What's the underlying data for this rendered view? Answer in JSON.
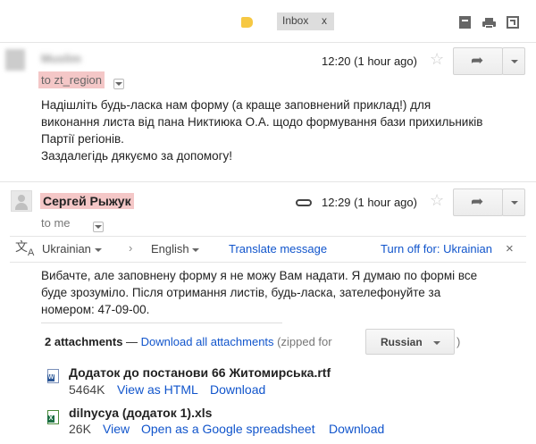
{
  "toolbar": {
    "label_tag": "Inbox",
    "label_remove": "x"
  },
  "message1": {
    "sender": "Muslim",
    "time": "12:20 (1 hour ago)",
    "to": "to zt_region",
    "body": [
      "Надішліть будь-ласка нам форму (а краще заповнений приклад!) для",
      "виконання листа від пана Никтиюка О.А. щодо формування бази прихильників",
      "Партії регіонів.",
      "Заздалегідь дякуємо за допомогу!"
    ]
  },
  "message2": {
    "sender": "Сергей Рыжук",
    "time": "12:29 (1 hour ago)",
    "to": "to me",
    "translate": {
      "from_lang": "Ukrainian",
      "to_lang": "English",
      "translate_link": "Translate message",
      "turn_off": "Turn off for: Ukrainian",
      "close": "×"
    },
    "body": [
      "Вибачте, але заповнену форму я не можу Вам надати. Я думаю по формі все",
      "буде зрозуміло. Після отримання листів, будь-ласка, зателефонуйте за",
      "номером: 47-09-00."
    ],
    "attachments_count": "2 attachments",
    "attachments_sep": "—",
    "download_all": "Download all attachments",
    "zipped_for": "(zipped for",
    "zipped_close": ")",
    "zip_lang": "Russian",
    "attachments": [
      {
        "name": "Додаток до постанови 66 Житомирська.rtf",
        "size": "5464K",
        "links": [
          "View as HTML",
          "Download"
        ]
      },
      {
        "name": "dilnycya (додаток 1).xls",
        "size": "26K",
        "links": [
          "View",
          "Open as a Google spreadsheet",
          "Download"
        ]
      }
    ]
  },
  "colors": {
    "link": "#1155cc",
    "highlight": "#f4c7c7",
    "label_tag": "#f6c843"
  }
}
